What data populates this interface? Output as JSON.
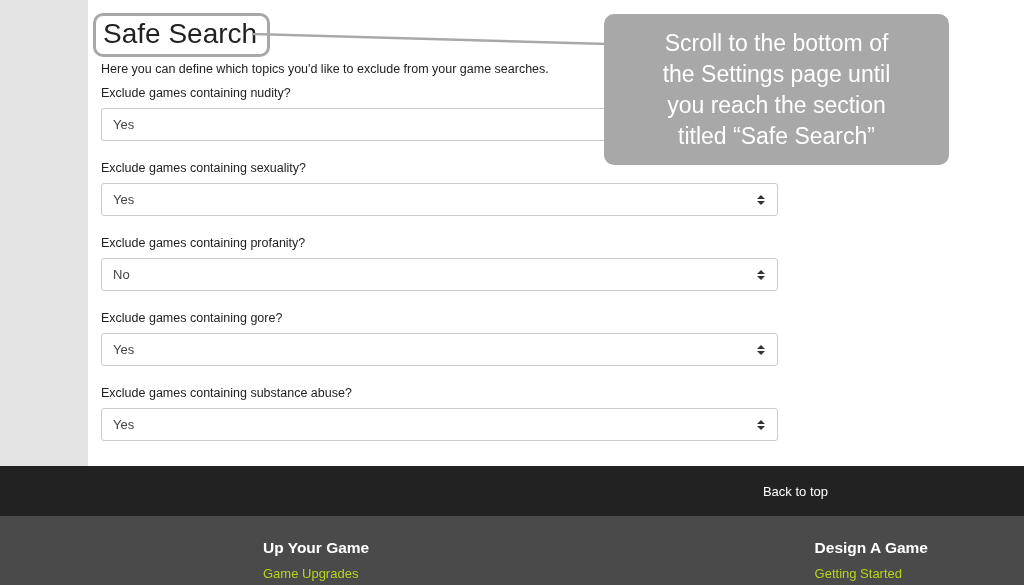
{
  "section": {
    "title": "Safe Search",
    "description": "Here you can define which topics you'd like to exclude from your game searches."
  },
  "fields": [
    {
      "label": "Exclude games containing nudity?",
      "value": "Yes",
      "covered": true
    },
    {
      "label": "Exclude games containing sexuality?",
      "value": "Yes"
    },
    {
      "label": "Exclude games containing profanity?",
      "value": "No"
    },
    {
      "label": "Exclude games containing gore?",
      "value": "Yes"
    },
    {
      "label": "Exclude games containing substance abuse?",
      "value": "Yes"
    }
  ],
  "callout": {
    "text": "Scroll to the bottom of the Settings page until you reach the section titled “Safe Search”"
  },
  "footer": {
    "back_to_top": "Back to top",
    "columns": [
      {
        "heading": "Up Your Game",
        "links": [
          "Game Upgrades"
        ]
      },
      {
        "heading": "Design A Game",
        "links": [
          "Getting Started"
        ]
      }
    ]
  }
}
